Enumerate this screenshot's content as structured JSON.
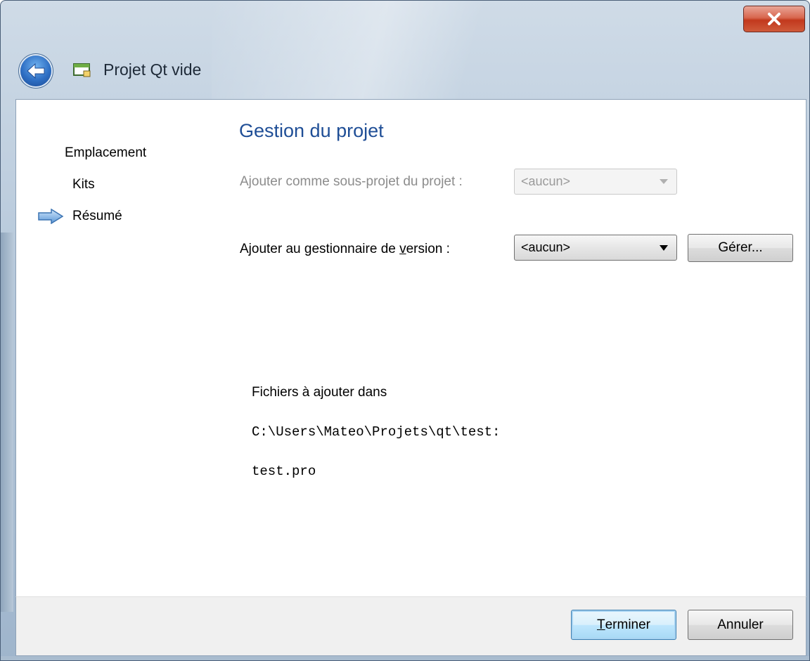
{
  "window": {
    "title": "Projet Qt vide"
  },
  "sidebar": {
    "items": [
      {
        "label": "Emplacement"
      },
      {
        "label": "Kits"
      },
      {
        "label": "Résumé",
        "current": true
      }
    ]
  },
  "main": {
    "title": "Gestion du projet",
    "subproject": {
      "label": "Ajouter comme sous-projet du projet :",
      "value": "<aucun>"
    },
    "vcs": {
      "label_pre": "Ajouter au gestionnaire de ",
      "label_mnemonic": "v",
      "label_post": "ersion :",
      "value": "<aucun>",
      "manage_button": "Gérer..."
    },
    "summary": {
      "intro": "Fichiers à ajouter dans",
      "path": "C:\\Users\\Mateo\\Projets\\qt\\test:",
      "file": "test.pro"
    }
  },
  "footer": {
    "finish_mnemonic": "T",
    "finish_rest": "erminer",
    "cancel": "Annuler"
  },
  "colors": {
    "title_accent": "#1f4e96",
    "close_button": "#c2391d"
  }
}
